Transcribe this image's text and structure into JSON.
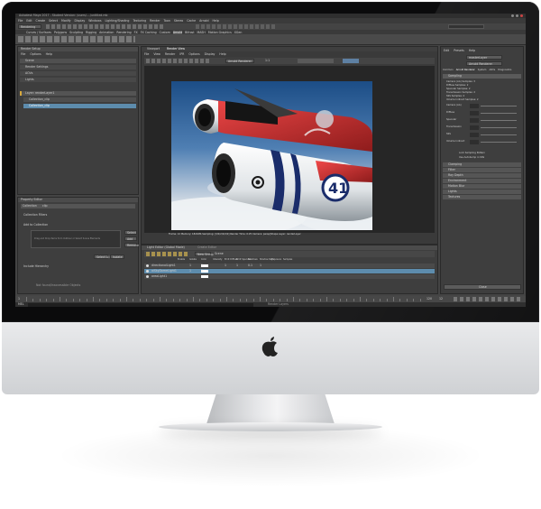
{
  "app": {
    "title": "Autodesk Maya 2017 - Student Version: /users/..../untitled.mb",
    "menus": [
      "File",
      "Edit",
      "Create",
      "Select",
      "Modify",
      "Display",
      "Windows",
      "Lighting/Shading",
      "Texturing",
      "Render",
      "Toon",
      "Stereo",
      "Cache",
      "Arnold",
      "Help"
    ],
    "workspace": "Rendering",
    "shelf_tabs": [
      "Curves / Surfaces",
      "Polygons",
      "Sculpting",
      "Rigging",
      "Animation",
      "Rendering",
      "FX",
      "FX Caching",
      "Custom",
      "Arnold",
      "Bifrost",
      "MASH",
      "Motion Graphics",
      "XGen"
    ],
    "shelf_active": "Arnold"
  },
  "render_setup": {
    "title": "Render Setup",
    "menus": [
      "File",
      "Options",
      "Help"
    ],
    "layer": "Scene",
    "render_settings": "Render Settings",
    "aovs": "AOVs",
    "lights": "Lights",
    "collection_layer": "Layer: renderLayer1",
    "collections": [
      "Collection_clip",
      "Collection_clip"
    ],
    "visible_layers": "Visible Layers"
  },
  "property_editor": {
    "title": "Property Editor",
    "collection_label": "Collection",
    "collection_value": "clip",
    "filters_label": "Collection Filters",
    "add_label": "Add to Collection",
    "drag_hint": "Drag and Drop items from Outliner or Select Scene Elements",
    "buttons": [
      "Select",
      "Add",
      "Remove",
      "Select All",
      "Isolate"
    ],
    "include_label": "Include Hierarchy",
    "not_found": "Not found/Inaccessible Objects"
  },
  "render_view": {
    "tabs": [
      "Viewport",
      "Render View"
    ],
    "menus": [
      "File",
      "View",
      "Render",
      "IPR",
      "Options",
      "Display",
      "Help"
    ],
    "renderer": "Arnold Renderer",
    "zoom": "1:1",
    "status": "Frame: 12  Memory: 1824Mb  Sampling: [3/2/2/2/2/2]  Render Time: 0:25  Camera: persp|Shape  Layer: renderLayer"
  },
  "light_editor": {
    "title": "Light Editor (Global Mode)",
    "tab2": "Create Editor",
    "new_group": "New Group",
    "scene": "Scene",
    "columns": [
      "Name",
      "Enable",
      "Isolate",
      "Color",
      "Intensity",
      "Emit Diffuse",
      "Emit Specular",
      "Shadows",
      "Shadow Rays",
      "Exposure",
      "Samples"
    ],
    "rows": [
      {
        "name": "directionalLight1",
        "values": [
          "1",
          "1",
          "",
          "1",
          "1",
          "0.1",
          "1"
        ]
      },
      {
        "name": "aiSkyDomeLight1",
        "values": [
          "1",
          "1",
          "",
          "",
          "",
          "",
          ""
        ]
      },
      {
        "name": "areaLight1",
        "values": [
          "",
          "",
          "",
          "",
          "",
          "",
          ""
        ]
      }
    ]
  },
  "render_settings": {
    "menus": [
      "Edit",
      "Presets",
      "Help"
    ],
    "render_layer": "masterLayer",
    "render_using": "Arnold Renderer",
    "tabs": [
      "Common",
      "Arnold Renderer",
      "System",
      "AOVs",
      "Diagnostics"
    ],
    "section_sampling": "Sampling",
    "sampling_rows": [
      "Camera (AA) Samples: 3",
      "Diffuse Samples: 2",
      "Specular Samples: 2",
      "Transmission Samples: 2",
      "SSS Samples: 2",
      "Volume Indirect Samples: 2"
    ],
    "params": [
      "Camera (AA)",
      "Diffuse",
      "Specular",
      "Transmission",
      "SSS",
      "Volume Indirect"
    ],
    "checks": [
      "Lock Sampling Pattern",
      "Use Autobump in SSS"
    ],
    "sections": [
      "Clamping",
      "Filter",
      "Ray Depth",
      "Environment",
      "Motion Blur",
      "Lights",
      "Textures"
    ],
    "close": "Close"
  },
  "timeline": {
    "start": "1",
    "end": "120",
    "current": "12"
  },
  "command_line": {
    "label": "MEL",
    "help": "Render Layers"
  }
}
